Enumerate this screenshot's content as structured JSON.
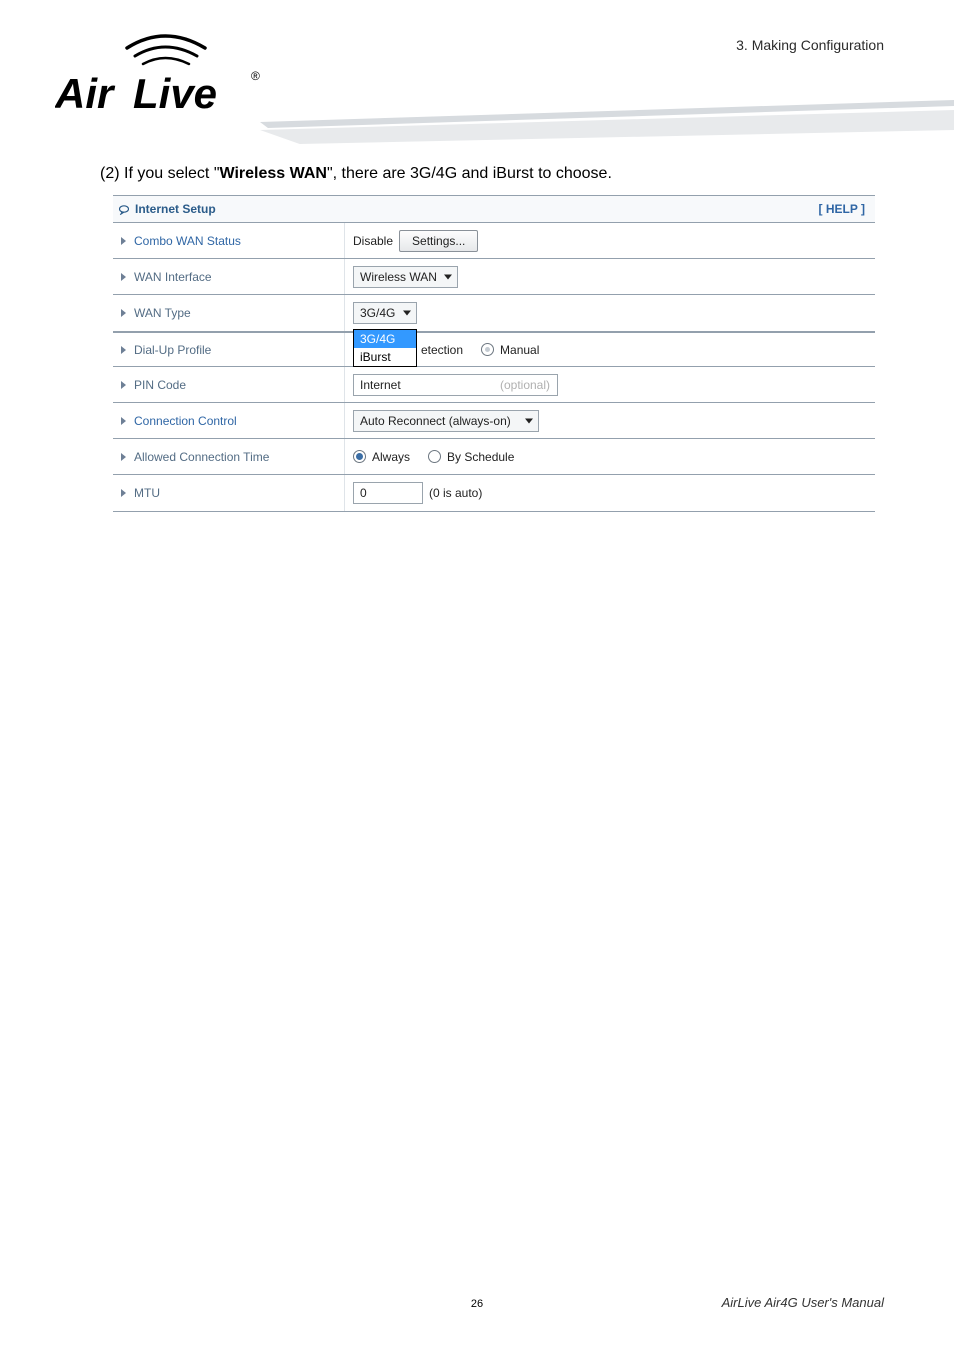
{
  "header": {
    "chapter": "3. Making Configuration"
  },
  "logo": {
    "brand": "Air Live",
    "reg": "®"
  },
  "intro": {
    "prefix": "(2) If you select \"",
    "bold": "Wireless WAN",
    "suffix": "\", there are 3G/4G and iBurst to choose."
  },
  "panel": {
    "title": "Internet Setup",
    "help": "[ HELP ]",
    "rows": {
      "combo": {
        "label": "Combo WAN Status",
        "status": "Disable",
        "button": "Settings..."
      },
      "waninterface": {
        "label": "WAN Interface",
        "value": "Wireless WAN"
      },
      "wantype": {
        "label": "WAN Type",
        "value": "3G/4G",
        "options": [
          "3G/4G",
          "iBurst"
        ],
        "selected_index": 0
      },
      "dialup": {
        "label": "Dial-Up Profile",
        "fragment_a": "etection",
        "fragment_b": "Manual"
      },
      "pincode": {
        "label": "PIN Code",
        "value": "Internet",
        "hint": "(optional)"
      },
      "conncontrol": {
        "label": "Connection Control",
        "value": "Auto Reconnect (always-on)"
      },
      "allowedtime": {
        "label": "Allowed Connection Time",
        "opt_a": "Always",
        "opt_b": "By Schedule",
        "selected": "a"
      },
      "mtu": {
        "label": "MTU",
        "value": "0",
        "note": "(0 is auto)"
      }
    }
  },
  "footer": {
    "page": "26",
    "manual": "AirLive Air4G User's Manual"
  }
}
